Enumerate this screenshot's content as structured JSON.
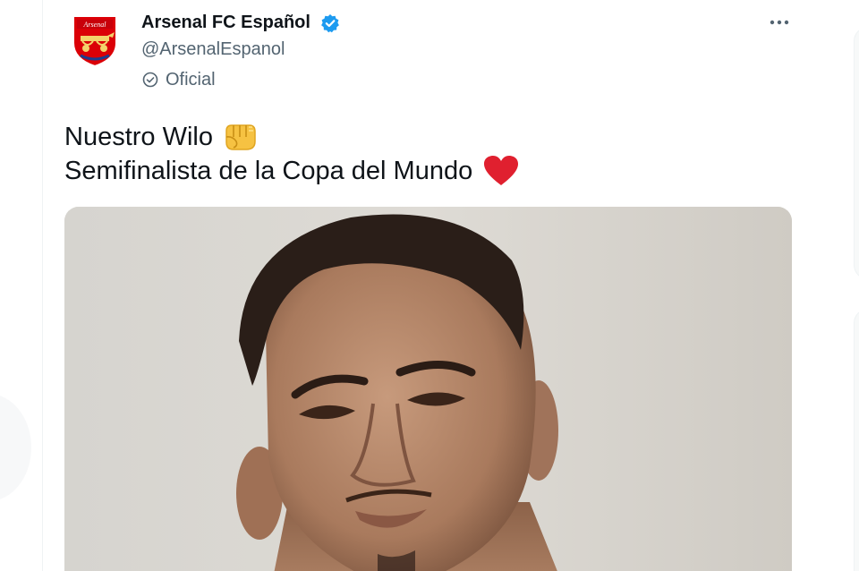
{
  "account": {
    "display_name": "Arsenal FC Español",
    "handle": "@ArsenalEspanol",
    "badge_label": "Oficial",
    "crest_text": "Arsenal"
  },
  "tweet": {
    "line1": "Nuestro Wilo",
    "line2": "Semifinalista de la Copa del Mundo"
  },
  "icons": {
    "verified": "verified-badge-icon",
    "official": "official-check-icon",
    "more": "more-options-icon",
    "fist": "oncoming-fist-emoji",
    "heart": "red-heart-emoji"
  },
  "colors": {
    "verified_blue": "#1d9bf0",
    "text_primary": "#0f1419",
    "text_secondary": "#536471",
    "crest_red": "#db0007",
    "heart_red": "#e0202f"
  }
}
